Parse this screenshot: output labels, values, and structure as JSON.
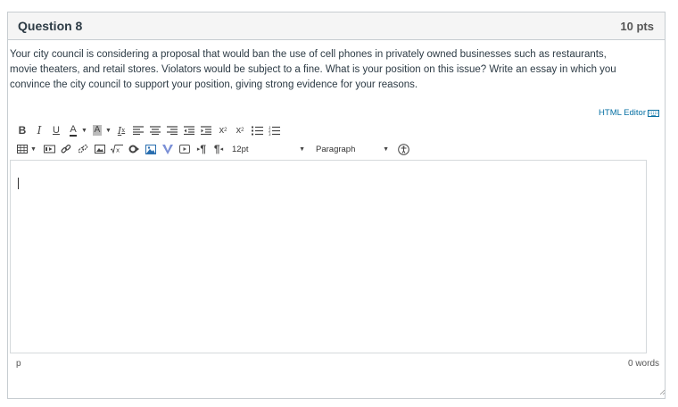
{
  "question": {
    "title": "Question 8",
    "points": "10 pts",
    "prompt": "Your city council is considering a proposal that would ban the use of cell phones in privately owned businesses such as restaurants, movie theaters, and retail stores. Violators would be subject to a fine. What is your position on this issue? Write an essay in which you convince the city council to support your position, giving strong evidence for your reasons."
  },
  "editor": {
    "html_editor_label": "HTML Editor",
    "font_size": "12pt",
    "block_format": "Paragraph",
    "content": "",
    "status_path": "p",
    "word_count": "0 words"
  },
  "toolbar": {
    "bold": "B",
    "italic": "I",
    "underline": "U",
    "font_color": "A",
    "background_color": "A",
    "clear_format": "I",
    "superscript": "x",
    "subscript": "x",
    "ltr": "¶",
    "rtl": "¶"
  }
}
